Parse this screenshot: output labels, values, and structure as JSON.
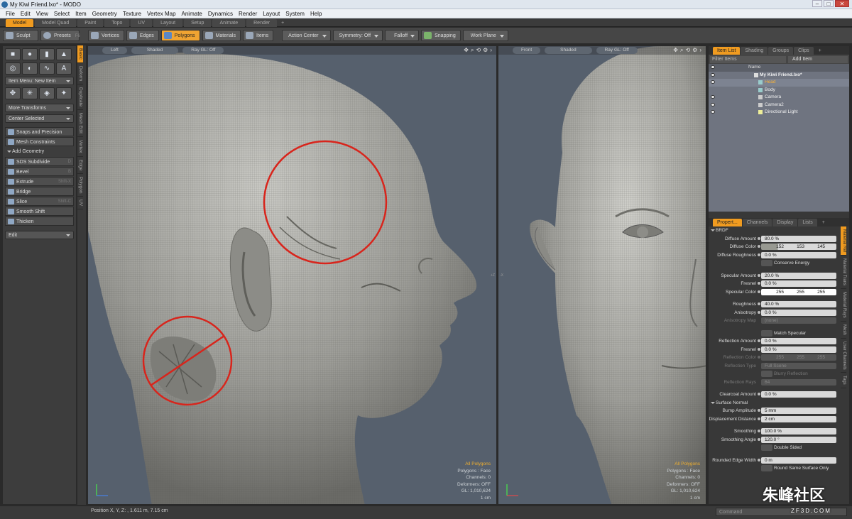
{
  "window": {
    "title": "My Kiwi Friend.lxo* - MODO",
    "controls": [
      "–",
      "□",
      "✕"
    ]
  },
  "menubar": [
    "File",
    "Edit",
    "View",
    "Select",
    "Item",
    "Geometry",
    "Texture",
    "Vertex Map",
    "Animate",
    "Dynamics",
    "Render",
    "Layout",
    "System",
    "Help"
  ],
  "layout_tabs": [
    {
      "label": "Model",
      "active": true
    },
    {
      "label": "Model Quad"
    },
    {
      "label": "Paint"
    },
    {
      "label": "Topo"
    },
    {
      "label": "UV"
    },
    {
      "label": "Layout"
    },
    {
      "label": "Setup"
    },
    {
      "label": "Animate"
    },
    {
      "label": "Render"
    },
    {
      "label": "+"
    }
  ],
  "toolbar": {
    "sculpt": "Sculpt",
    "presets": "Presets",
    "presets_key": "F6",
    "vertices": "Vertices",
    "edges": "Edges",
    "polygons": "Polygons",
    "materials": "Materials",
    "items": "Items",
    "action_center": "Action Center",
    "symmetry": "Symmetry: Off",
    "falloff": "Falloff",
    "snapping": "Snapping",
    "work_plane": "Work Plane"
  },
  "left_panel": {
    "item_menu": "Item Menu: New Item",
    "more_transforms": "More Transforms",
    "center_selected": "Center Selected",
    "snaps_and_precision": "Snaps and Precision",
    "mesh_constraints": "Mesh Constraints",
    "add_geometry": "Add Geometry",
    "tools": [
      {
        "label": "SDS Subdivide",
        "key": "D"
      },
      {
        "label": "Bevel",
        "key": "B"
      },
      {
        "label": "Extrude",
        "key": "Shift-X"
      },
      {
        "label": "Bridge",
        "key": ""
      },
      {
        "label": "Slice",
        "key": "Shift-C"
      },
      {
        "label": "Smooth Shift",
        "key": ""
      },
      {
        "label": "Thicken",
        "key": ""
      }
    ],
    "edit": "Edit"
  },
  "side_tabs": [
    "Basic",
    "Deform",
    "Duplicate",
    "Mesh Edit",
    "Vertex",
    "Edge",
    "Polygon",
    "UV"
  ],
  "viewport_left": {
    "view": "Left",
    "shading": "Shaded",
    "raygl": "Ray GL: Off",
    "info": [
      "All Polygons",
      "Polygons : Face",
      "Channels: 0",
      "Deformers: OFF",
      "GL: 1,010,624",
      "1 cm"
    ],
    "edge_label": "+Z"
  },
  "viewport_right": {
    "view": "Front",
    "shading": "Shaded",
    "raygl": "Ray GL: Off",
    "info": [
      "All Polygons",
      "Polygons : Face",
      "Channels: 0",
      "Deformers: OFF",
      "GL: 1,010,624",
      "1 cm"
    ],
    "edge_label": "-X"
  },
  "statusbar": {
    "position": "Position X, Y, Z:   , 1.611 m, 7.15 cm",
    "command_placeholder": "Command"
  },
  "item_list": {
    "tabs": [
      "Item List",
      "Shading",
      "Groups",
      "Clips",
      "+"
    ],
    "filter": "Filter Items",
    "add_item": "Add Item",
    "col_name": "Name",
    "items": [
      {
        "name": "My Kiwi Friend.lxo*",
        "depth": 0,
        "selected": false
      },
      {
        "name": "Head",
        "depth": 1,
        "selected": true
      },
      {
        "name": "Body",
        "depth": 1,
        "selected": false
      },
      {
        "name": "Camera",
        "depth": 1,
        "selected": false
      },
      {
        "name": "Camera2",
        "depth": 1,
        "selected": false
      },
      {
        "name": "Directional Light",
        "depth": 1,
        "selected": false
      }
    ]
  },
  "properties": {
    "tabs": [
      "Propert...",
      "Channels",
      "Display",
      "Lists",
      "+"
    ],
    "side_tabs": [
      "Material Ref",
      "Material Trans",
      "Material Rays",
      "Mesh",
      "User Channels",
      "Tags"
    ],
    "brdf": "BRDF",
    "diffuse_amount": {
      "label": "Diffuse Amount",
      "value": "80.0 %"
    },
    "diffuse_color": {
      "label": "Diffuse Color",
      "r": "152",
      "g": "153",
      "b": "145"
    },
    "diffuse_roughness": {
      "label": "Diffuse Roughness",
      "value": "0.0 %"
    },
    "conserve_energy": "Conserve Energy",
    "specular_amount": {
      "label": "Specular Amount",
      "value": "20.0 %"
    },
    "fresnel": {
      "label": "Fresnel",
      "value": "0.0 %"
    },
    "specular_color": {
      "label": "Specular Color",
      "r": "255",
      "g": "255",
      "b": "255"
    },
    "roughness": {
      "label": "Roughness",
      "value": "40.0 %"
    },
    "anisotropy": {
      "label": "Anisotropy",
      "value": "0.0 %"
    },
    "anisotropy_map": {
      "label": "Anisotropy Map",
      "value": "(none)"
    },
    "match_specular": "Match Specular",
    "reflection_amount": {
      "label": "Reflection Amount",
      "value": "0.0 %"
    },
    "fresnel2": {
      "label": "Fresnel",
      "value": "0.0 %"
    },
    "reflection_color": {
      "label": "Reflection Color",
      "r": "255",
      "g": "255",
      "b": "255"
    },
    "reflection_type": {
      "label": "Reflection Type",
      "value": "Full Scene"
    },
    "blurry_reflection": "Blurry Reflection",
    "reflection_rays": {
      "label": "Reflection Rays",
      "value": "64"
    },
    "clearcoat_amount": {
      "label": "Clearcoat Amount",
      "value": "0.0 %"
    },
    "surface_normal": "Surface Normal",
    "bump_amplitude": {
      "label": "Bump Amplitude",
      "value": "5 mm"
    },
    "displacement_distance": {
      "label": "Displacement Distance",
      "value": "2 cm"
    },
    "smoothing": {
      "label": "Smoothing",
      "value": "100.0 %"
    },
    "smoothing_angle": {
      "label": "Smoothing Angle",
      "value": "120.0 °"
    },
    "double_sided": "Double Sided",
    "rounded_edge_width": {
      "label": "Rounded Edge Width",
      "value": "0 m"
    },
    "round_same_surface": "Round Same Surface Only"
  },
  "watermark": {
    "text": "朱峰社区",
    "sub": "ZF3D.COM"
  }
}
